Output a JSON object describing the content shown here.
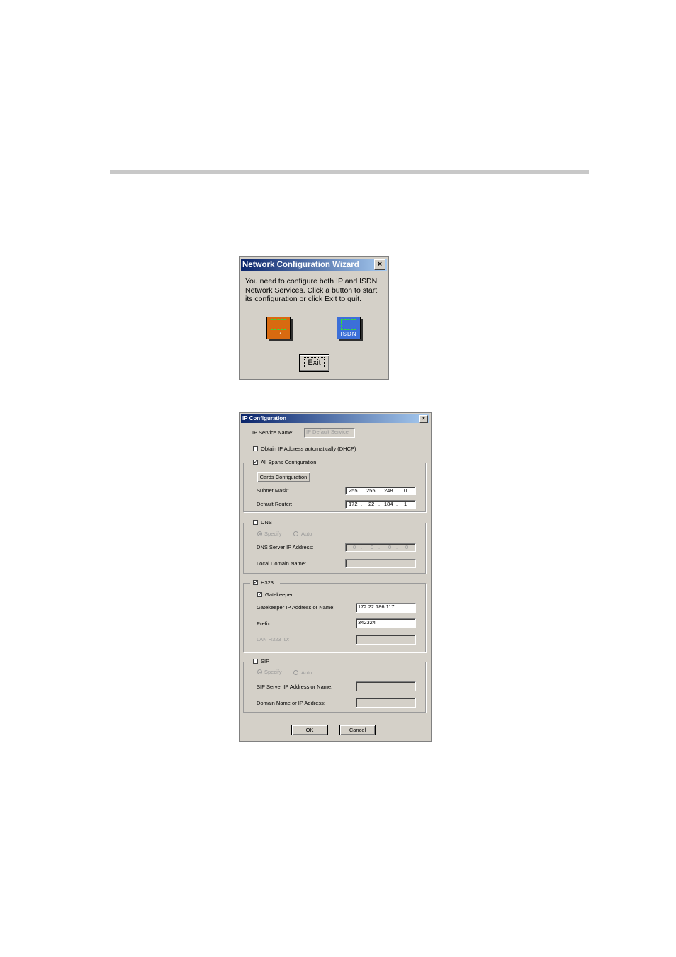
{
  "wizard": {
    "title": "Network Configuration Wizard",
    "close_label": "×",
    "message": "You need to configure both IP and ISDN Network Services. Click a button to start its configuration or click Exit to quit.",
    "ip_label": "IP",
    "isdn_label": "ISDN",
    "exit_label": "Exit"
  },
  "ipcfg": {
    "title": "IP Configuration",
    "close_label": "×",
    "service_name_label": "IP Service Name:",
    "service_name_value": "IP Default Service",
    "dhcp_label": "Obtain IP Address automatically (DHCP)",
    "dhcp_checked": false,
    "spans": {
      "label": "All Spans Configuration",
      "checked": true,
      "cards_button": "Cards Configuration",
      "subnet_label": "Subnet Mask:",
      "subnet": [
        "255",
        "255",
        "248",
        "0"
      ],
      "router_label": "Default Router:",
      "router": [
        "172",
        "22",
        "184",
        "1"
      ]
    },
    "dns": {
      "label": "DNS",
      "checked": false,
      "specify": "Specify",
      "auto": "Auto",
      "server_label": "DNS Server IP Address:",
      "server": [
        "0",
        "0",
        "0",
        "0"
      ],
      "domain_label": "Local Domain Name:"
    },
    "h323": {
      "label": "H323",
      "checked": true,
      "gatekeeper_label": "Gatekeeper",
      "gatekeeper_checked": true,
      "gk_ip_label": "Gatekeeper IP Address or Name:",
      "gk_ip_value": "172.22.186.117",
      "prefix_label": "Prefix:",
      "prefix_value": "342324",
      "lan_label": "LAN H323 ID:"
    },
    "sip": {
      "label": "SIP",
      "checked": false,
      "specify": "Specify",
      "auto": "Auto",
      "server_label": "SIP Server IP Address or Name:",
      "domain_label": "Domain Name or IP Address:"
    },
    "ok_label": "OK",
    "cancel_label": "Cancel",
    "dot": "."
  }
}
